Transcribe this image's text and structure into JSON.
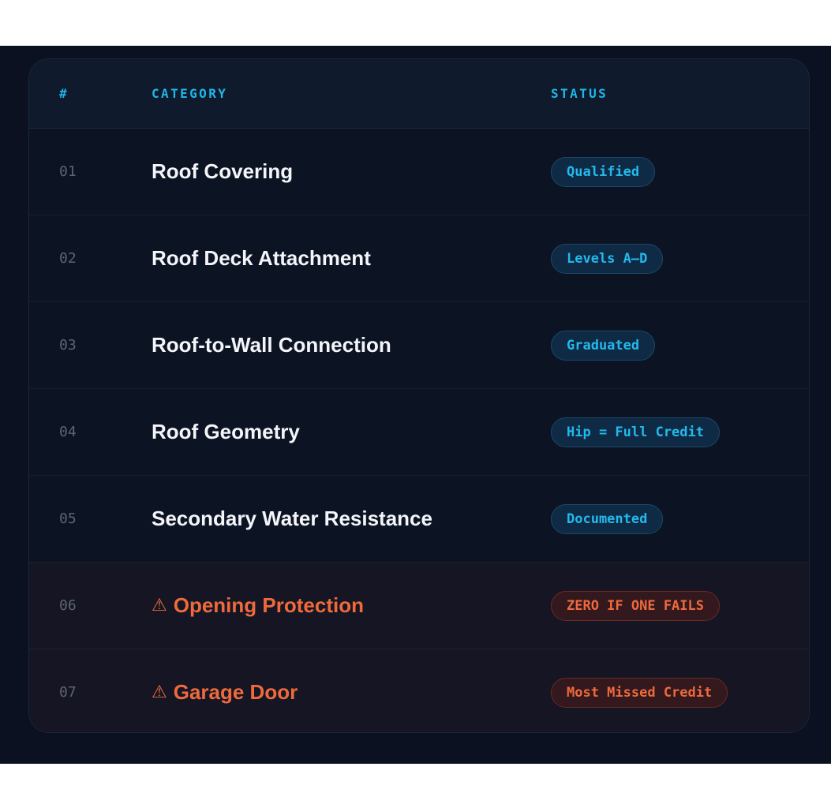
{
  "table": {
    "headers": {
      "number": "#",
      "category": "CATEGORY",
      "status": "STATUS"
    },
    "rows": [
      {
        "number": "01",
        "category": "Roof Covering",
        "status": "Qualified",
        "warning": false
      },
      {
        "number": "02",
        "category": "Roof Deck Attachment",
        "status": "Levels A–D",
        "warning": false
      },
      {
        "number": "03",
        "category": "Roof-to-Wall Connection",
        "status": "Graduated",
        "warning": false
      },
      {
        "number": "04",
        "category": "Roof Geometry",
        "status": "Hip = Full Credit",
        "warning": false
      },
      {
        "number": "05",
        "category": "Secondary Water Resistance",
        "status": "Documented",
        "warning": false
      },
      {
        "number": "06",
        "category": "Opening Protection",
        "status": "ZERO IF ONE FAILS",
        "warning": true,
        "icon": "⚠"
      },
      {
        "number": "07",
        "category": "Garage Door",
        "status": "Most Missed Credit",
        "warning": true,
        "icon": "⚠"
      }
    ]
  },
  "colors": {
    "background": "#0b1120",
    "header_accent": "#1fb6e8",
    "badge_info": "#24b9ec",
    "warning": "#ee6a3c"
  }
}
